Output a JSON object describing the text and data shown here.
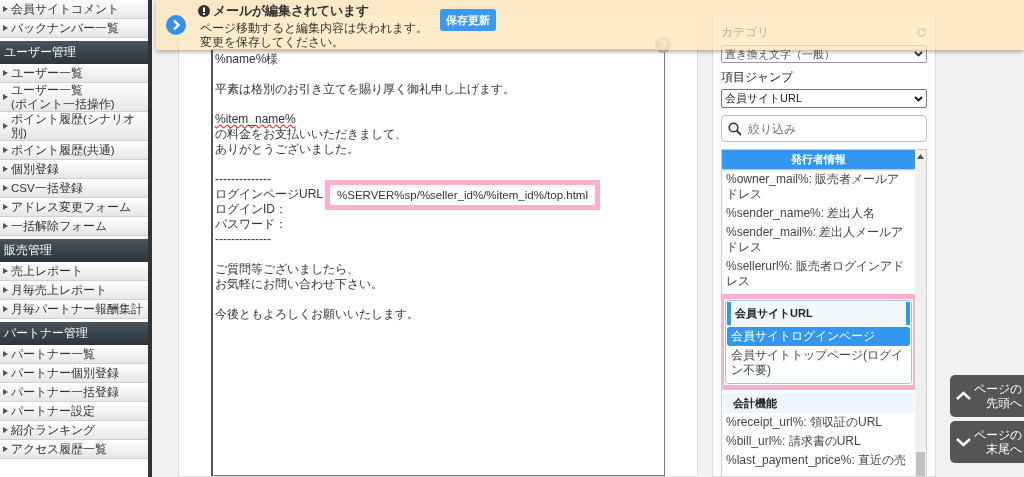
{
  "sidebar": {
    "items": [
      {
        "kind": "item",
        "label": "会員サイトコメント"
      },
      {
        "kind": "item",
        "label": "バックナンバー一覧"
      },
      {
        "kind": "header",
        "label": "ユーザー管理"
      },
      {
        "kind": "item",
        "label": "ユーザー一覧"
      },
      {
        "kind": "item",
        "label": "ユーザー一覧\n(ポイント一括操作)"
      },
      {
        "kind": "item",
        "label": "ポイント履歴(シナリオ別)"
      },
      {
        "kind": "item",
        "label": "ポイント履歴(共通)"
      },
      {
        "kind": "item",
        "label": "個別登録"
      },
      {
        "kind": "item",
        "label": "CSV一括登録"
      },
      {
        "kind": "item",
        "label": "アドレス変更フォーム"
      },
      {
        "kind": "item",
        "label": "一括解除フォーム"
      },
      {
        "kind": "header",
        "label": "販売管理"
      },
      {
        "kind": "item",
        "label": "売上レポート"
      },
      {
        "kind": "item",
        "label": "月毎売上レポート"
      },
      {
        "kind": "item",
        "label": "月毎パートナー報酬集計"
      },
      {
        "kind": "header",
        "label": "パートナー管理"
      },
      {
        "kind": "item",
        "label": "パートナー一覧"
      },
      {
        "kind": "item",
        "label": "パートナー個別登録"
      },
      {
        "kind": "item",
        "label": "パートナー一括登録"
      },
      {
        "kind": "item",
        "label": "パートナー設定"
      },
      {
        "kind": "item",
        "label": "紹介ランキング"
      },
      {
        "kind": "item",
        "label": "アクセス履歴一覧"
      }
    ]
  },
  "banner": {
    "title": "メールが編集されています",
    "message_lines": [
      "ページ移動すると編集内容は失われます。",
      "変更を保存してください。"
    ],
    "button": "保存更新"
  },
  "editor": {
    "lines": [
      {
        "kind": "text",
        "text": "%name%様"
      },
      {
        "kind": "blank"
      },
      {
        "kind": "text",
        "text": "平素は格別のお引き立てを賜り厚く御礼申し上げます。"
      },
      {
        "kind": "blank"
      },
      {
        "kind": "text",
        "text": "%item_name%",
        "misspelled": true
      },
      {
        "kind": "text",
        "text": "の料金をお支払いいただきまして、"
      },
      {
        "kind": "text",
        "text": "ありがとうございました。"
      },
      {
        "kind": "blank"
      },
      {
        "kind": "text",
        "text": "--------------"
      },
      {
        "kind": "text",
        "text": "ログインページURL",
        "highlight": "%SERVER%sp/%seller_id%/%item_id%/top.html"
      },
      {
        "kind": "text",
        "text": "ログインID："
      },
      {
        "kind": "text",
        "text": "パスワード："
      },
      {
        "kind": "text",
        "text": "--------------"
      },
      {
        "kind": "blank"
      },
      {
        "kind": "text",
        "text": "ご質問等ございましたら、"
      },
      {
        "kind": "text",
        "text": "お気軽にお問い合わせ下さい。"
      },
      {
        "kind": "blank"
      },
      {
        "kind": "text",
        "text": "今後ともよろしくお願いいたします。"
      }
    ]
  },
  "side_panel": {
    "category": {
      "label": "カテゴリ",
      "value": "置き換え文字（一般）"
    },
    "jump": {
      "label": "項目ジャンプ",
      "value": "会員サイトURL"
    },
    "search": {
      "placeholder": "絞り込み"
    },
    "groups": [
      {
        "kind": "current",
        "title": "発行者情報",
        "options": [
          {
            "label": "%owner_mail%: 販売者メールアドレス",
            "selected": false
          },
          {
            "label": "%sender_name%: 差出人名",
            "selected": false
          },
          {
            "label": "%sender_mail%: 差出人メールアドレス",
            "selected": false
          },
          {
            "label": "%sellerurl%: 販売者ログインアドレス",
            "selected": false
          }
        ]
      },
      {
        "kind": "highlighted",
        "title": "会員サイトURL",
        "options": [
          {
            "label": "会員サイトログインページ",
            "selected": true
          },
          {
            "label": "会員サイトトップページ(ログイン不要)",
            "selected": false
          }
        ]
      },
      {
        "kind": "plain",
        "title": "会計機能",
        "options": [
          {
            "label": "%receipt_url%: 領収証のURL",
            "selected": false
          },
          {
            "label": "%bill_url%: 請求書のURL",
            "selected": false
          },
          {
            "label": "%last_payment_price%: 直近の売",
            "selected": false
          }
        ]
      }
    ]
  },
  "nav_buttons": [
    {
      "kind": "up",
      "lines": [
        "ページの",
        "先頭へ"
      ]
    },
    {
      "kind": "down",
      "lines": [
        "ページの",
        "末尾へ"
      ]
    }
  ]
}
